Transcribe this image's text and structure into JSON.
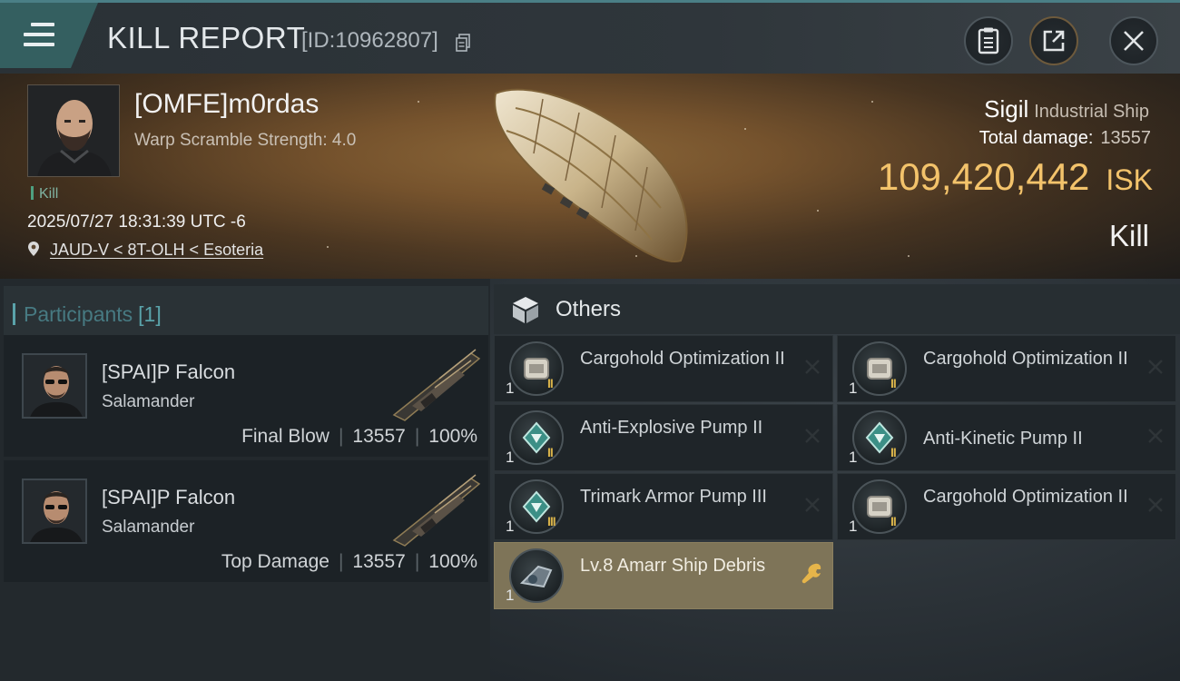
{
  "header": {
    "title": "KILL REPORT",
    "report_id": "[ID:10962807]",
    "icons": [
      "menu-icon",
      "copy-icon",
      "clipboard-icon",
      "share-icon",
      "close-icon"
    ]
  },
  "victim": {
    "name": "[OMFE]m0rdas",
    "warp_scramble": "Warp Scramble Strength: 4.0",
    "tag": "Kill",
    "datetime": "2025/07/27 18:31:39 UTC -6",
    "location": "JAUD-V < 8T-OLH < Esoteria",
    "ship_name": "Sigil",
    "ship_class": "Industrial Ship",
    "total_damage_label": "Total damage:",
    "total_damage_value": "13557",
    "isk_value": "109,420,442",
    "isk_unit": "ISK",
    "result": "Kill"
  },
  "participants": {
    "label": "Participants",
    "count": "[1]",
    "rows": [
      {
        "name": "[SPAI]P Falcon",
        "ship": "Salamander",
        "role": "Final Blow",
        "damage": "13557",
        "percent": "100%"
      },
      {
        "name": "[SPAI]P Falcon",
        "ship": "Salamander",
        "role": "Top Damage",
        "damage": "13557",
        "percent": "100%"
      }
    ]
  },
  "others": {
    "label": "Others",
    "items": [
      {
        "name": "Cargohold Optimization II",
        "qty": "1",
        "tier": "II",
        "icon": "cargo-module-icon"
      },
      {
        "name": "Cargohold Optimization II",
        "qty": "1",
        "tier": "II",
        "icon": "cargo-module-icon"
      },
      {
        "name": "Anti-Explosive Pump II",
        "qty": "1",
        "tier": "II",
        "icon": "armor-pump-icon"
      },
      {
        "name": "Anti-Kinetic Pump II",
        "qty": "1",
        "tier": "II",
        "icon": "armor-pump-icon"
      },
      {
        "name": "Trimark Armor Pump III",
        "qty": "1",
        "tier": "III",
        "icon": "armor-pump-icon"
      },
      {
        "name": "Cargohold Optimization II",
        "qty": "1",
        "tier": "II",
        "icon": "cargo-module-icon"
      },
      {
        "name": "Lv.8 Amarr Ship Debris",
        "qty": "1",
        "tier": "",
        "icon": "debris-icon"
      }
    ]
  },
  "colors": {
    "accent": "#5aa3aa",
    "isk": "#f3c36b",
    "highlight": "#7e7458",
    "header_button": "#345f60"
  }
}
